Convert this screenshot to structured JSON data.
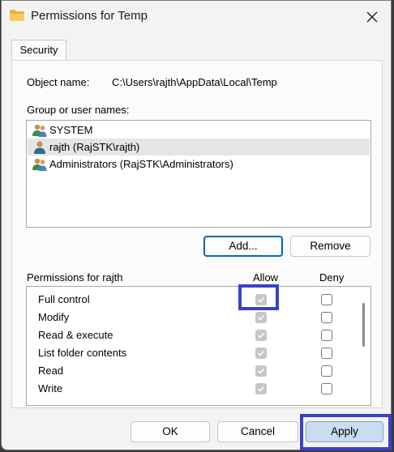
{
  "window": {
    "title": "Permissions for Temp"
  },
  "tabs": [
    {
      "label": "Security"
    }
  ],
  "object": {
    "label": "Object name:",
    "value": "C:\\Users\\rajth\\AppData\\Local\\Temp"
  },
  "groups": {
    "label": "Group or user names:",
    "items": [
      {
        "name": "SYSTEM",
        "icon": "users-group-icon",
        "selected": false
      },
      {
        "name": "rajth (RajSTK\\rajth)",
        "icon": "user-icon",
        "selected": true
      },
      {
        "name": "Administrators (RajSTK\\Administrators)",
        "icon": "users-group-icon",
        "selected": false
      }
    ]
  },
  "buttons": {
    "add": "Add...",
    "remove": "Remove",
    "ok": "OK",
    "cancel": "Cancel",
    "apply": "Apply"
  },
  "permissions": {
    "label": "Permissions for rajth",
    "allow_header": "Allow",
    "deny_header": "Deny",
    "rows": [
      {
        "name": "Full control",
        "allow": true,
        "deny": false
      },
      {
        "name": "Modify",
        "allow": true,
        "deny": false
      },
      {
        "name": "Read & execute",
        "allow": true,
        "deny": false
      },
      {
        "name": "List folder contents",
        "allow": true,
        "deny": false
      },
      {
        "name": "Read",
        "allow": true,
        "deny": false
      },
      {
        "name": "Write",
        "allow": true,
        "deny": false
      }
    ]
  },
  "colors": {
    "highlight": "#3a41c8",
    "focus": "#0067c0",
    "selection": "#e5e5e5",
    "apply_bg": "#c9dcf0"
  }
}
